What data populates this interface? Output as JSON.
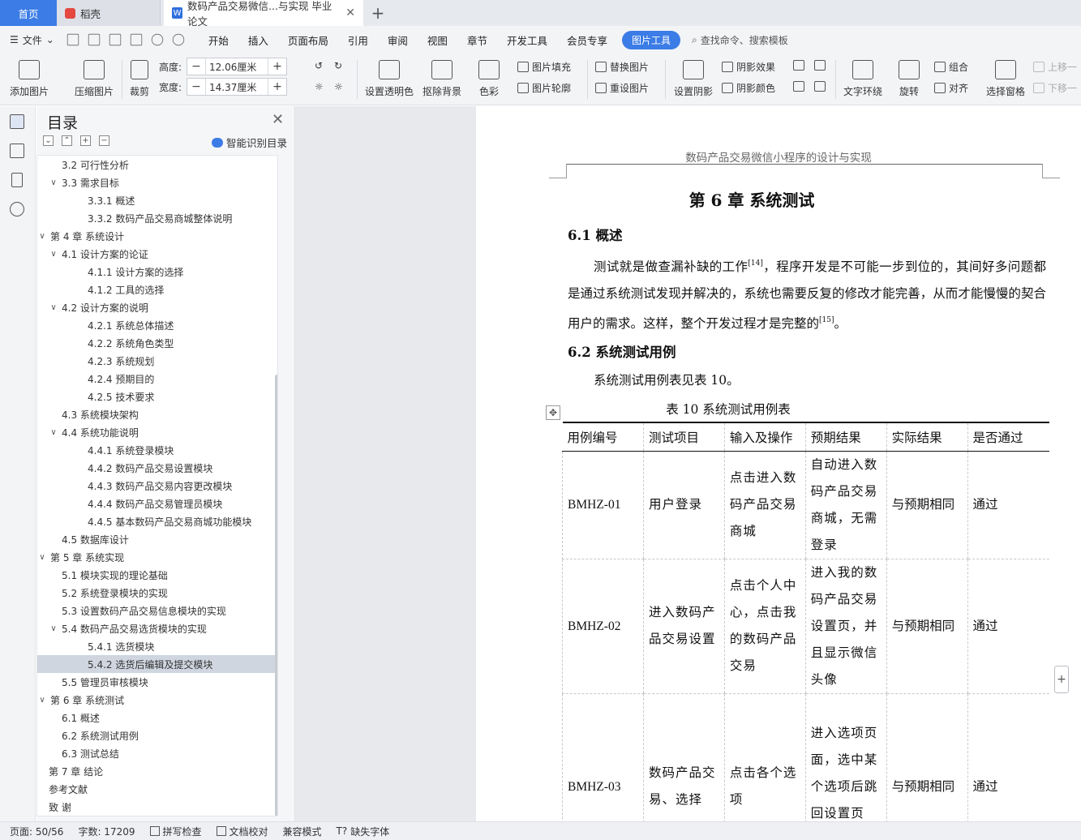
{
  "tabs": {
    "home": "首页",
    "daoke": "稻壳",
    "doc": "数码产品交易微信...与实现 毕业论文",
    "doc_icon": "W"
  },
  "menu": {
    "file": "文件",
    "items": [
      "开始",
      "插入",
      "页面布局",
      "引用",
      "审阅",
      "视图",
      "章节",
      "开发工具",
      "会员专享"
    ],
    "active": "图片工具",
    "search": "查找命令、搜索模板"
  },
  "ribbon": {
    "add_image": "添加图片",
    "compress": "压缩图片",
    "crop": "裁剪",
    "height_label": "高度:",
    "height_value": "12.06厘米",
    "width_label": "宽度:",
    "width_value": "14.37厘米",
    "set_transparent": "设置透明色",
    "remove_bg": "抠除背景",
    "color": "色彩",
    "image_fill": "图片填充",
    "image_outline": "图片轮廓",
    "replace_image": "替换图片",
    "reset_image": "重设图片",
    "set_shadow": "设置阴影",
    "shadow_effect": "阴影效果",
    "shadow_color": "阴影颜色",
    "text_wrap": "文字环绕",
    "rotate": "旋转",
    "group": "组合",
    "align": "对齐",
    "selection_pane": "选择窗格",
    "bring_forward": "上移一",
    "send_backward": "下移一"
  },
  "toc": {
    "title": "目录",
    "smart": "智能识别目录",
    "items": [
      {
        "label": "3.2  可行性分析",
        "level": 2,
        "chev": ""
      },
      {
        "label": "3.3  需求目标",
        "level": 2,
        "chev": "v"
      },
      {
        "label": "3.3.1  概述",
        "level": 3,
        "chev": ""
      },
      {
        "label": "3.3.2  数码产品交易商城整体说明",
        "level": 3,
        "chev": ""
      },
      {
        "label": "第 4 章  系统设计",
        "level": 1,
        "chev": "v"
      },
      {
        "label": "4.1  设计方案的论证",
        "level": 2,
        "chev": "v"
      },
      {
        "label": "4.1.1  设计方案的选择",
        "level": 3,
        "chev": ""
      },
      {
        "label": "4.1.2  工具的选择",
        "level": 3,
        "chev": ""
      },
      {
        "label": "4.2  设计方案的说明",
        "level": 2,
        "chev": "v"
      },
      {
        "label": "4.2.1  系统总体描述",
        "level": 3,
        "chev": ""
      },
      {
        "label": "4.2.2  系统角色类型",
        "level": 3,
        "chev": ""
      },
      {
        "label": "4.2.3  系统规划",
        "level": 3,
        "chev": ""
      },
      {
        "label": "4.2.4  预期目的",
        "level": 3,
        "chev": ""
      },
      {
        "label": "4.2.5  技术要求",
        "level": 3,
        "chev": ""
      },
      {
        "label": "4.3  系统模块架构",
        "level": 2,
        "chev": ""
      },
      {
        "label": "4.4  系统功能说明",
        "level": 2,
        "chev": "v"
      },
      {
        "label": "4.4.1  系统登录模块",
        "level": 3,
        "chev": ""
      },
      {
        "label": "4.4.2  数码产品交易设置模块",
        "level": 3,
        "chev": ""
      },
      {
        "label": "4.4.3  数码产品交易内容更改模块",
        "level": 3,
        "chev": ""
      },
      {
        "label": "4.4.4  数码产品交易管理员模块",
        "level": 3,
        "chev": ""
      },
      {
        "label": "4.4.5  基本数码产品交易商城功能模块",
        "level": 3,
        "chev": ""
      },
      {
        "label": "4.5  数据库设计",
        "level": 2,
        "chev": ""
      },
      {
        "label": "第 5 章  系统实现",
        "level": 1,
        "chev": "v"
      },
      {
        "label": "5.1  模块实现的理论基础",
        "level": 2,
        "chev": ""
      },
      {
        "label": "5.2  系统登录模块的实现",
        "level": 2,
        "chev": ""
      },
      {
        "label": "5.3  设置数码产品交易信息模块的实现",
        "level": 2,
        "chev": ""
      },
      {
        "label": "5.4  数码产品交易选货模块的实现",
        "level": 2,
        "chev": "v"
      },
      {
        "label": "5.4.1  选货模块",
        "level": 3,
        "chev": ""
      },
      {
        "label": "5.4.2  选货后编辑及提交模块",
        "level": 3,
        "chev": "",
        "selected": true
      },
      {
        "label": "5.5  管理员审核模块",
        "level": 2,
        "chev": ""
      },
      {
        "label": "第 6 章  系统测试",
        "level": 1,
        "chev": "v"
      },
      {
        "label": "6.1  概述",
        "level": 2,
        "chev": ""
      },
      {
        "label": "6.2  系统测试用例",
        "level": 2,
        "chev": ""
      },
      {
        "label": "6.3  测试总结",
        "level": 2,
        "chev": ""
      },
      {
        "label": "第 7 章  结论",
        "level": 1,
        "chev": ""
      },
      {
        "label": "参考文献",
        "level": 1,
        "chev": ""
      },
      {
        "label": "致    谢",
        "level": 1,
        "chev": ""
      }
    ]
  },
  "doc": {
    "running_head": "数码产品交易微信小程序的设计与实现",
    "chapter": "第 6 章  系统测试",
    "h_61": "6.1  概述",
    "p1_a": "测试就是做查漏补缺的工作",
    "ref14": "[14]",
    "p1_b": "，程序开发是不可能一步到位的，其间好多问题都是通过系统测试发现并解决的，系统也需要反复的修改才能完善，从而才能慢慢的契合用户的需求。这样，整个开发过程才是完整的",
    "ref15": "[15]",
    "p1_c": "。",
    "h_62": "6.2  系统测试用例",
    "p2": "系统测试用例表见表 10。",
    "table_caption": "表 10  系统测试用例表",
    "table_headers": [
      "用例编号",
      "测试项目",
      "输入及操作",
      "预期结果",
      "实际结果",
      "是否通过"
    ],
    "table_rows": [
      [
        "BMHZ-01",
        "用户登录",
        "点击进入数码产品交易商城",
        "自动进入数码产品交易商城，无需登录",
        "与预期相同",
        "通过"
      ],
      [
        "BMHZ-02",
        "进入数码产品交易设置",
        "点击个人中心，点击我的数码产品交易",
        "进入我的数码产品交易设置页，并且显示微信头像",
        "与预期相同",
        "通过"
      ],
      [
        "BMHZ-03",
        "数码产品交易、选择",
        "点击各个选项",
        "进入选项页面，选中某个选项后跳回设置页面，并将选",
        "与预期相同",
        "通过"
      ]
    ]
  },
  "status": {
    "page": "页面: 50/56",
    "words": "字数: 17209",
    "spell": "拼写检查",
    "proof": "文档校对",
    "compat": "兼容模式",
    "missing_font": "缺失字体"
  }
}
